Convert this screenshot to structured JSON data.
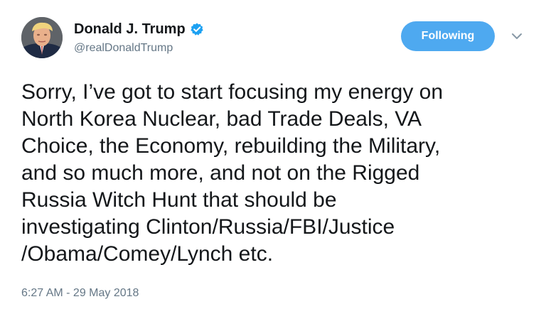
{
  "tweet": {
    "user": {
      "display_name": "Donald J. Trump",
      "screen_name": "@realDonaldTrump",
      "verified": true,
      "avatar_icon": "profile-photo"
    },
    "follow_button_label": "Following",
    "caret_icon": "chevron-down-icon",
    "text_lines": [
      "Sorry, I’ve got to start focusing my energy on",
      "North Korea Nuclear, bad Trade Deals, VA",
      "Choice, the Economy, rebuilding the Military,",
      "and so much more, and not on the Rigged",
      "Russia Witch Hunt that should be",
      "investigating Clinton/Russia/FBI/Justice",
      "/Obama/Comey/Lynch etc."
    ],
    "timestamp": "6:27 AM - 29 May 2018"
  },
  "colors": {
    "accent": "#4ea9f0",
    "verified": "#1da1f2",
    "secondary_text": "#657786",
    "primary_text": "#14171a"
  }
}
